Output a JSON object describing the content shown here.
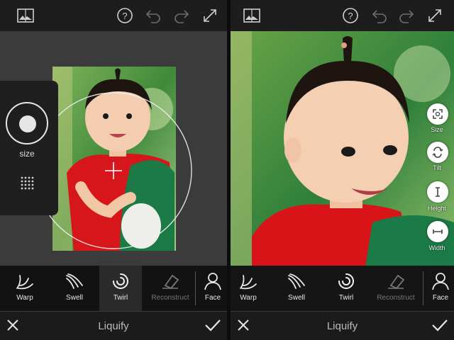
{
  "app": {
    "title": "Liquify"
  },
  "tools": [
    {
      "label": "Warp"
    },
    {
      "label": "Swell"
    },
    {
      "label": "Twirl"
    },
    {
      "label": "Reconstruct"
    },
    {
      "label": "Face"
    }
  ],
  "left_panel": {
    "size_label": "size"
  },
  "right_panel": {
    "face_controls": [
      {
        "label": "Size",
        "icon": "expand-face-icon"
      },
      {
        "label": "Tilt",
        "icon": "rotate-icon"
      },
      {
        "label": "Height",
        "icon": "height-icon"
      },
      {
        "label": "Width",
        "icon": "width-icon"
      }
    ]
  },
  "colors": {
    "accent": "#ffffff",
    "toolbar": "#121212",
    "topbar": "#1d1d1d"
  }
}
